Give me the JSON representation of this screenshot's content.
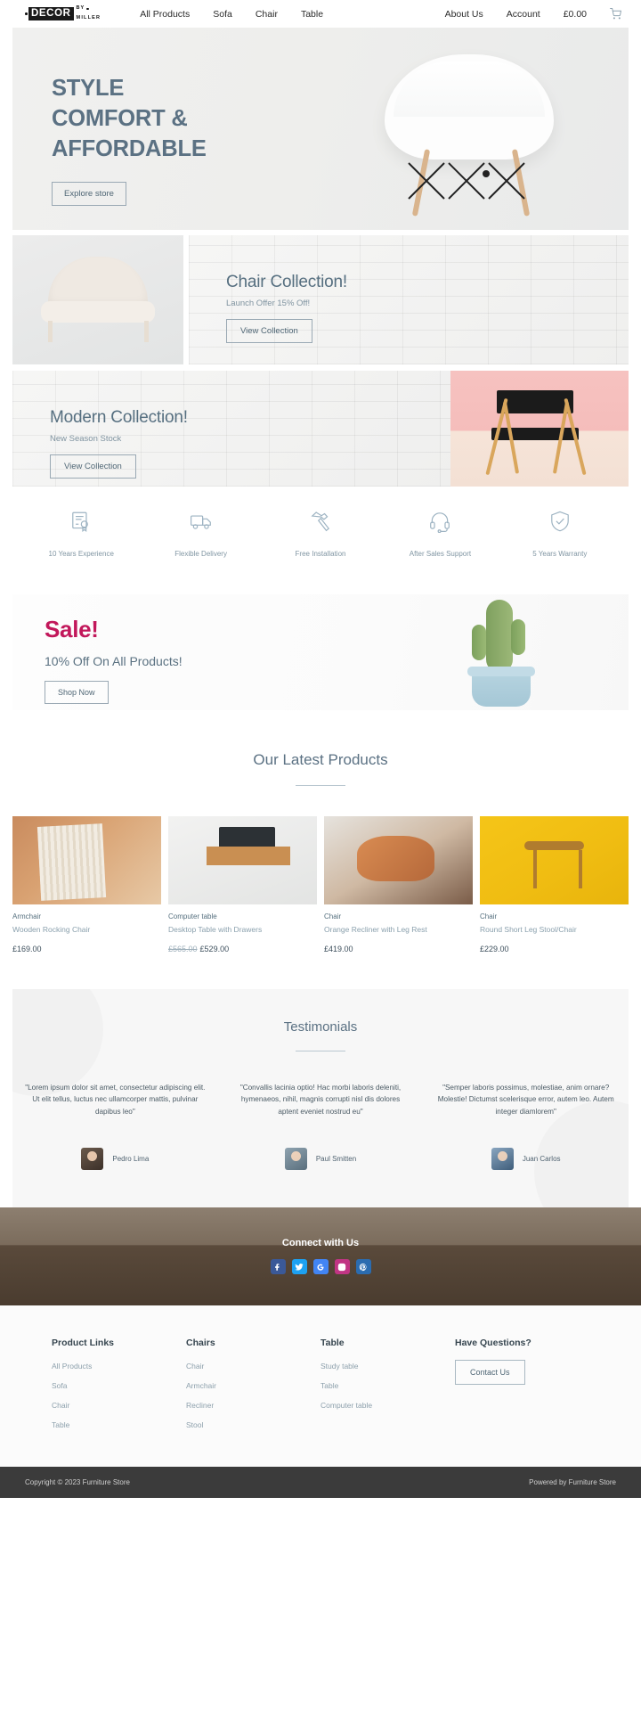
{
  "header": {
    "logo": {
      "main": "DECOR",
      "by": "BY",
      "miller": "MILLER"
    },
    "nav": [
      {
        "label": "All Products"
      },
      {
        "label": "Sofa"
      },
      {
        "label": "Chair"
      },
      {
        "label": "Table"
      }
    ],
    "right": [
      {
        "label": "About Us"
      },
      {
        "label": "Account"
      }
    ],
    "cart_total": "£0.00",
    "cart_icon": "shopping-cart-icon"
  },
  "hero": {
    "line1": "STYLE",
    "line2": "COMFORT &",
    "line3": "AFFORDABLE",
    "cta": "Explore store",
    "accent": "#5b7183"
  },
  "chair_collection": {
    "title": "Chair Collection!",
    "subtitle": "Launch Offer 15% Off!",
    "cta": "View Collection"
  },
  "modern_collection": {
    "title": "Modern Collection!",
    "subtitle": "New Season Stock",
    "cta": "View Collection"
  },
  "features": [
    {
      "icon": "certificate-icon",
      "label": "10 Years Experience"
    },
    {
      "icon": "delivery-truck-icon",
      "label": "Flexible Delivery"
    },
    {
      "icon": "hammer-icon",
      "label": "Free Installation"
    },
    {
      "icon": "headset-icon",
      "label": "After Sales Support"
    },
    {
      "icon": "shield-check-icon",
      "label": "5 Years Warranty"
    }
  ],
  "sale": {
    "title": "Sale!",
    "subtitle": "10% Off On All Products!",
    "cta": "Shop Now",
    "title_color": "#c2185b"
  },
  "latest_products": {
    "heading": "Our Latest Products",
    "items": [
      {
        "category": "Armchair",
        "name": "Wooden Rocking Chair",
        "price": "£169.00",
        "old_price": ""
      },
      {
        "category": "Computer table",
        "name": "Desktop Table with Drawers",
        "price": "£529.00",
        "old_price": "£565.00"
      },
      {
        "category": "Chair",
        "name": "Orange Recliner with Leg Rest",
        "price": "£419.00",
        "old_price": ""
      },
      {
        "category": "Chair",
        "name": "Round Short Leg Stool/Chair",
        "price": "£229.00",
        "old_price": ""
      }
    ]
  },
  "testimonials": {
    "heading": "Testimonials",
    "items": [
      {
        "quote": "\"Lorem ipsum dolor sit amet, consectetur adipiscing elit. Ut elit tellus, luctus nec ullamcorper mattis, pulvinar dapibus leo\"",
        "name": "Pedro Lima"
      },
      {
        "quote": "\"Convallis lacinia optio! Hac morbi laboris deleniti, hymenaeos, nihil, magnis corrupti nisl dis dolores aptent eveniet nostrud eu\"",
        "name": "Paul Smitten"
      },
      {
        "quote": "\"Semper laboris possimus, molestiae, anim ornare? Molestie! Dictumst scelerisque error, autem leo. Autem integer diamlorem\"",
        "name": "Juan Carlos"
      }
    ]
  },
  "connect": {
    "heading": "Connect with Us",
    "socials": [
      {
        "name": "facebook-icon",
        "color": "#3b5998"
      },
      {
        "name": "twitter-icon",
        "color": "#1da1f2"
      },
      {
        "name": "google-icon",
        "color": "#4285f4"
      },
      {
        "name": "instagram-icon",
        "color": "#c13584"
      },
      {
        "name": "pinterest-icon",
        "color": "#2b6cb0"
      }
    ]
  },
  "footer": {
    "columns": [
      {
        "title": "Product Links",
        "links": [
          {
            "label": "All Products"
          },
          {
            "label": "Sofa"
          },
          {
            "label": "Chair"
          },
          {
            "label": "Table"
          }
        ]
      },
      {
        "title": "Chairs",
        "links": [
          {
            "label": "Chair"
          },
          {
            "label": "Armchair"
          },
          {
            "label": "Recliner"
          },
          {
            "label": "Stool"
          }
        ]
      },
      {
        "title": "Table",
        "links": [
          {
            "label": "Study table"
          },
          {
            "label": "Table"
          },
          {
            "label": "Computer table"
          }
        ]
      }
    ],
    "questions": {
      "title": "Have Questions?",
      "cta": "Contact Us"
    },
    "copyright": "Copyright © 2023 Furniture Store",
    "powered": "Powered by Furniture Store"
  }
}
